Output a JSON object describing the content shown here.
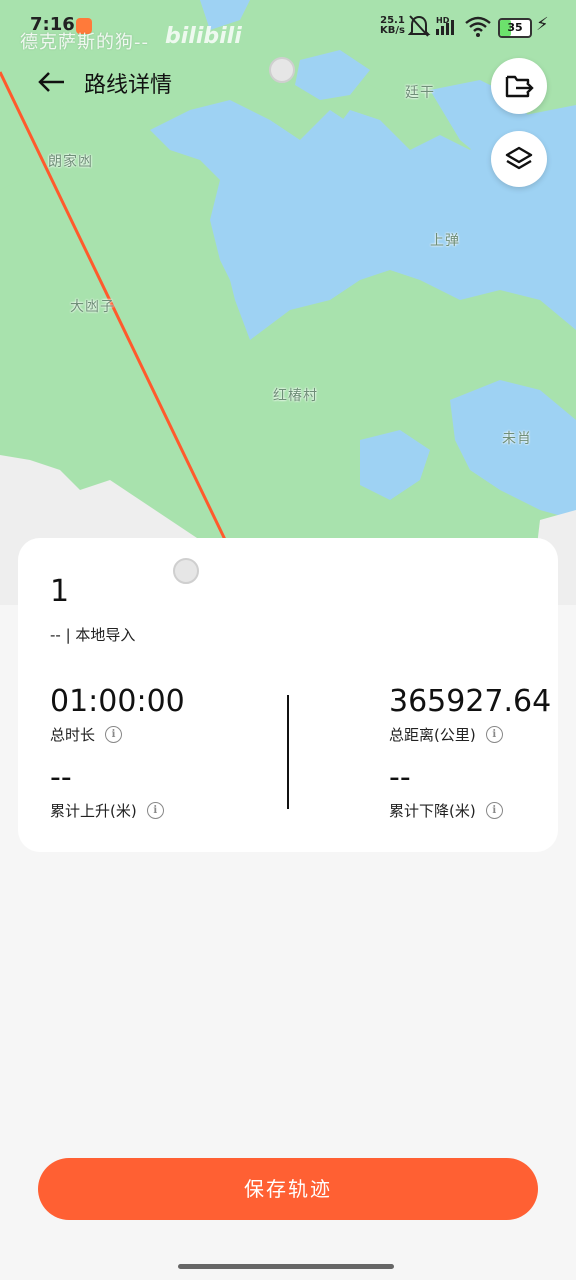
{
  "status_bar": {
    "time": "7:16",
    "watermark_text": "德克萨斯的狗--",
    "watermark_logo": "bilibili",
    "net_speed_value": "25.1",
    "net_speed_unit": "KB/s",
    "hd_label": "HD",
    "battery_level": "35",
    "icons": [
      "mute-bell-icon",
      "signal-icon",
      "wifi-icon",
      "battery-icon",
      "charging-icon"
    ]
  },
  "header": {
    "title": "路线详情",
    "back_icon": "arrow-left-icon",
    "export_icon": "export-icon",
    "layers_icon": "layers-icon"
  },
  "map": {
    "places": [
      {
        "name": "廷干"
      },
      {
        "name": "朗家凼"
      },
      {
        "name": "上弹"
      },
      {
        "name": "大凼子"
      },
      {
        "name": "红椿村"
      },
      {
        "name": "未肖"
      }
    ],
    "route_color": "#ff5a2c",
    "land_color": "#a8e2ad",
    "water_color": "#9ed2f3"
  },
  "route": {
    "name": "1",
    "source": "-- | 本地导入",
    "stats": {
      "duration": {
        "value": "01:00:00",
        "label": "总时长"
      },
      "distance": {
        "value": "365927.64",
        "label": "总距离(公里)"
      },
      "ascent": {
        "value": "--",
        "label": "累计上升(米)"
      },
      "descent": {
        "value": "--",
        "label": "累计下降(米)"
      }
    }
  },
  "actions": {
    "save_label": "保存轨迹"
  },
  "colors": {
    "accent": "#ff6033"
  }
}
